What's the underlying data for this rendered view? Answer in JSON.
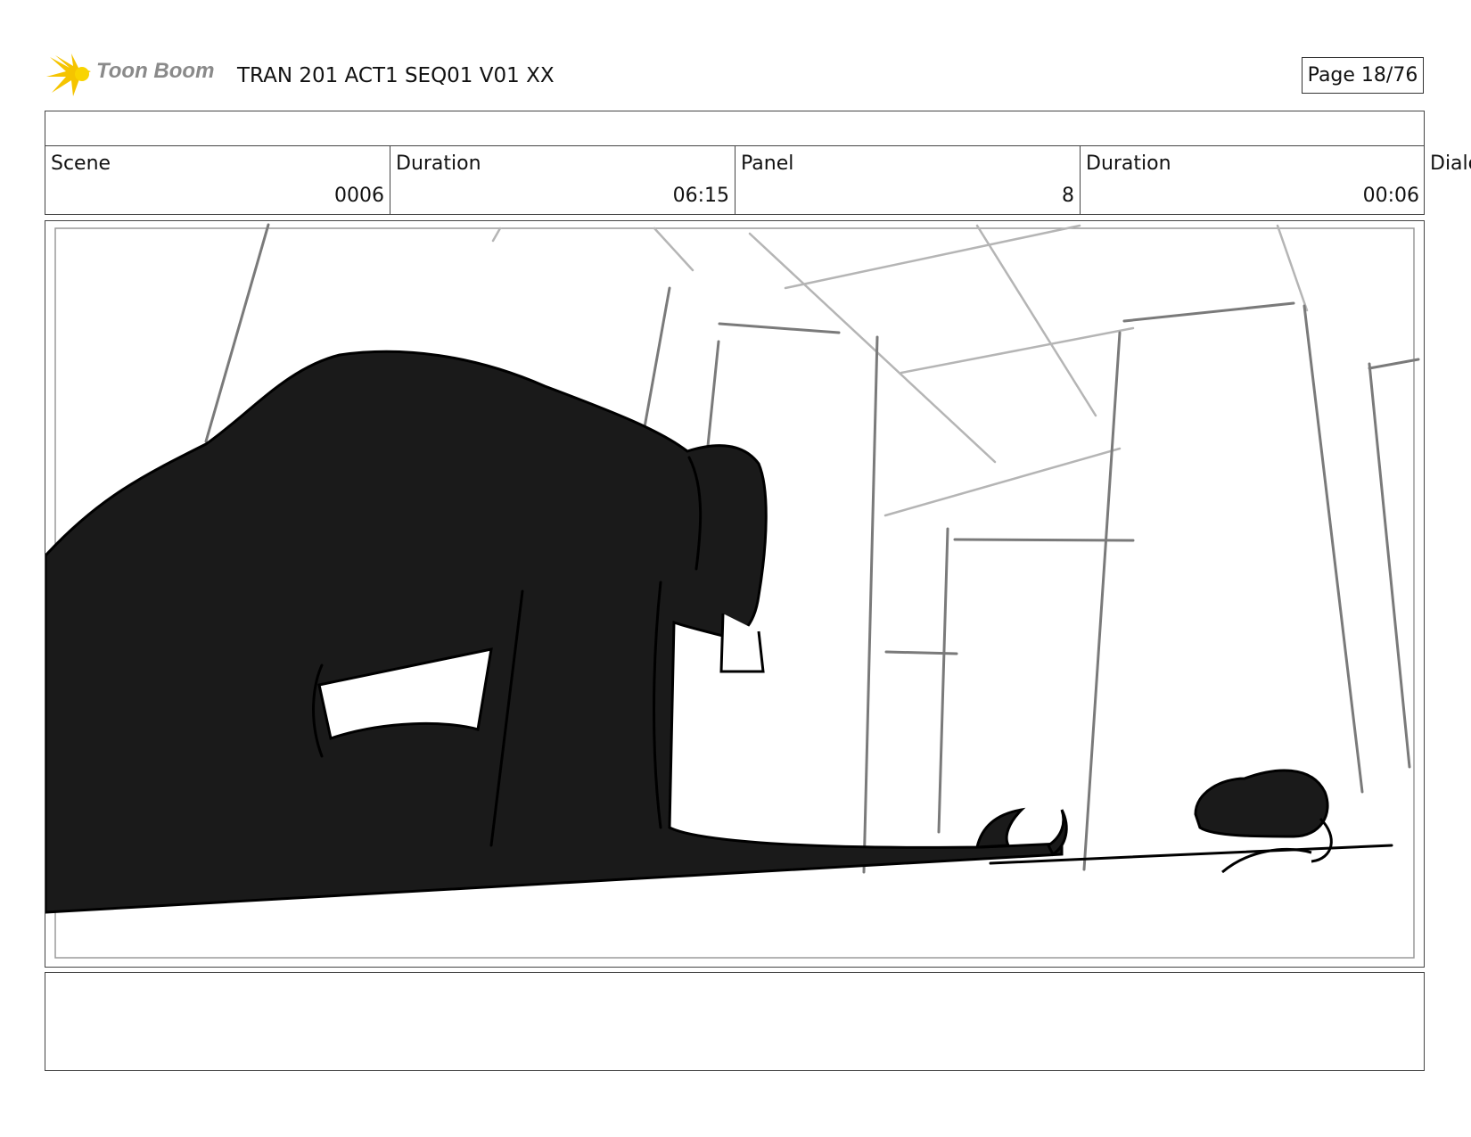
{
  "header": {
    "brand": "Toon Boom",
    "doc_title": "TRAN 201 ACT1 SEQ01 V01 XX",
    "page": "Page 18/76"
  },
  "info": {
    "scene_label": "Scene",
    "scene_value": "0006",
    "scene_duration_label": "Duration",
    "scene_duration_value": "06:15",
    "panel_label": "Panel",
    "panel_value": "8",
    "panel_duration_label": "Duration",
    "panel_duration_value": "00:06",
    "dialogue_label_partial": "Dialo"
  },
  "panel": {
    "icon": "storyboard-sketch-image",
    "ink_color": "#1a1a1a",
    "sketch_line_color": "#7a7a7a"
  },
  "colors": {
    "logo_yellow": "#f5c400",
    "logo_text": "#8a8a8a",
    "border": "#444444"
  }
}
